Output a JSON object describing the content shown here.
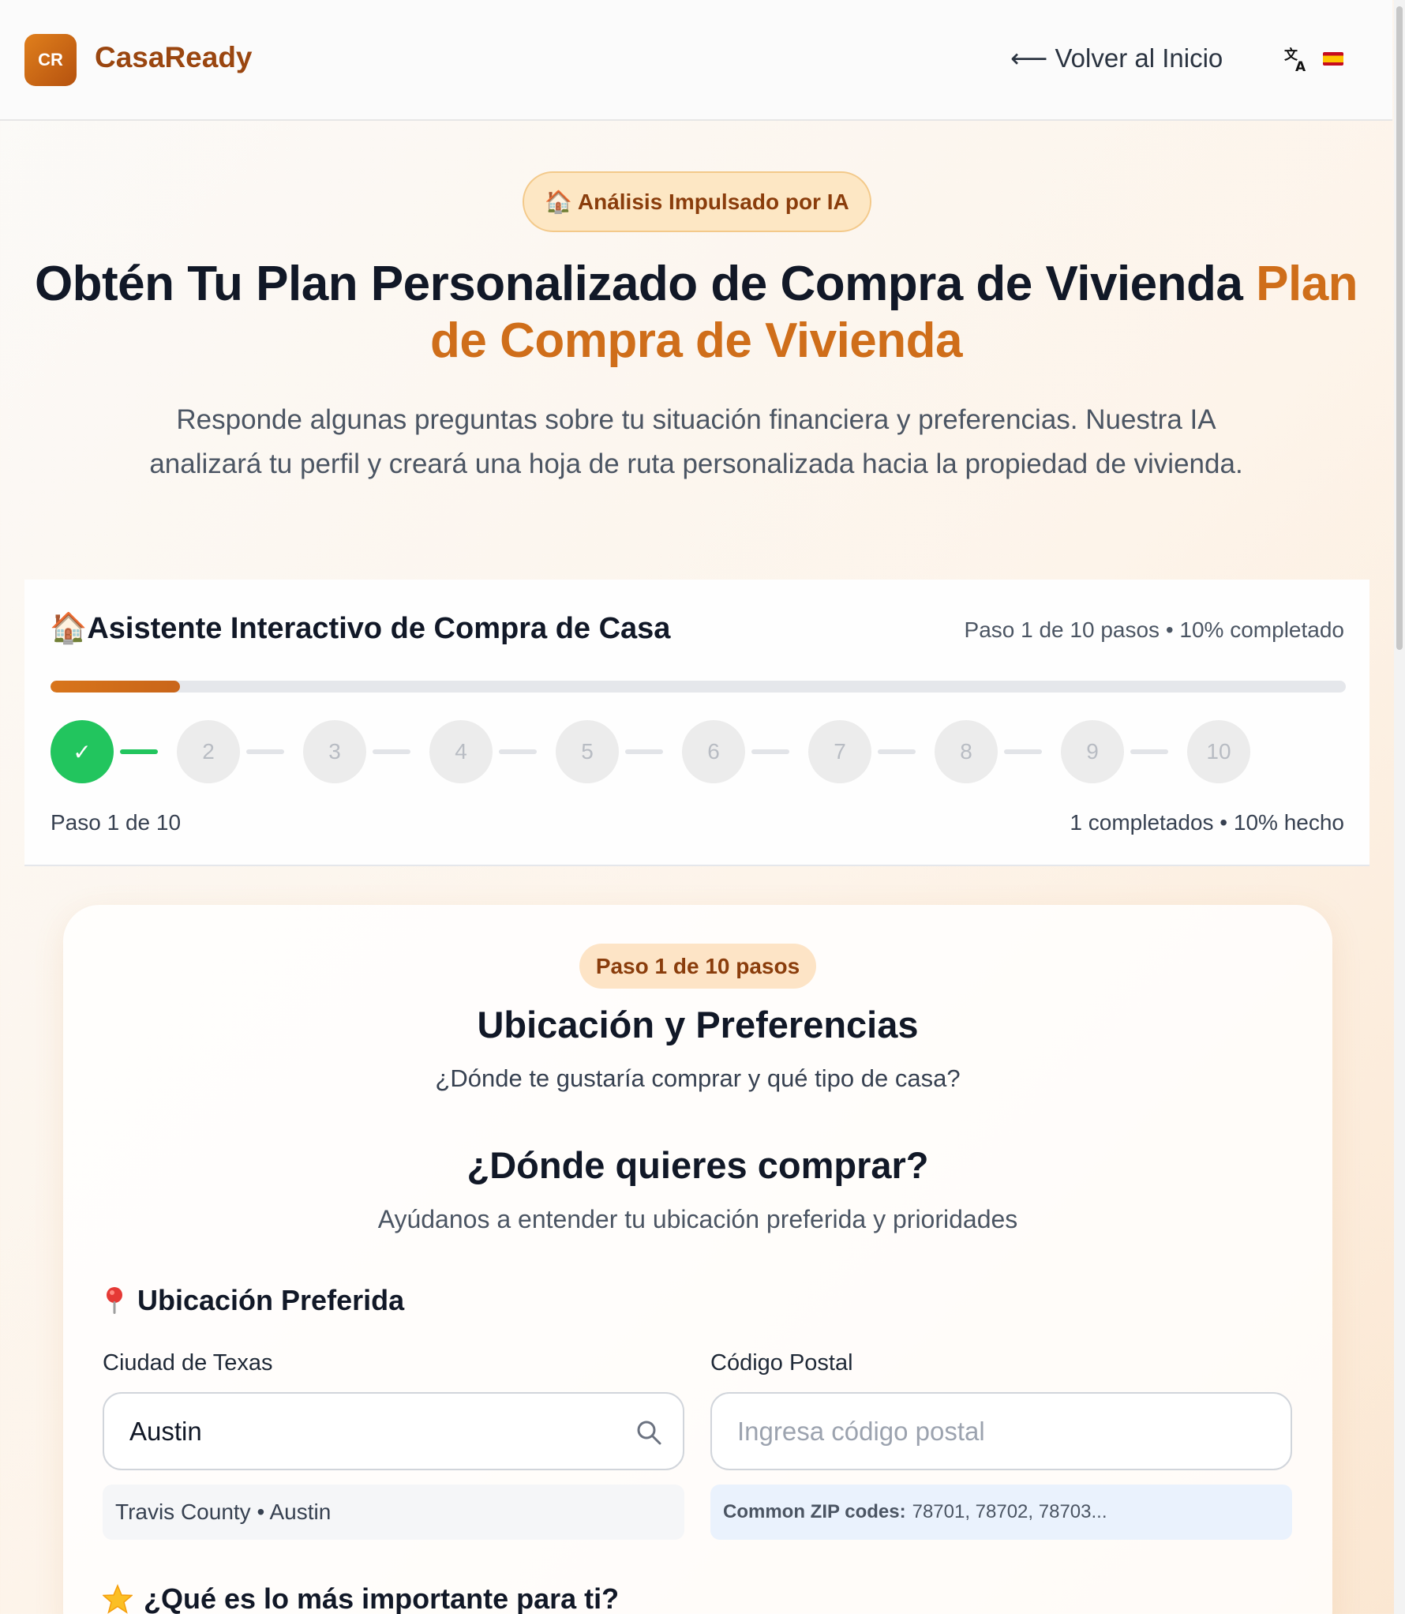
{
  "header": {
    "logo_text": "CR",
    "brand": "CasaReady",
    "back_link": "⟵ Volver al Inicio",
    "translate_icon": "translate-icon",
    "flag_icon": "spain-flag-icon"
  },
  "hero": {
    "badge": "🏠 Análisis Impulsado por IA",
    "title_main": "Obtén Tu Plan Personalizado de Compra de Vivienda ",
    "title_accent": "Plan de Compra de Vivienda",
    "subtitle": "Responde algunas preguntas sobre tu situación financiera y preferencias. Nuestra IA analizará tu perfil y creará una hoja de ruta personalizada hacia la propiedad de vivienda."
  },
  "wizard": {
    "title": "🏠Asistente Interactivo de Compra de Casa",
    "status": "Paso 1 de 10 pasos • 10% completado",
    "progress_fraction": 0.1,
    "steps": [
      "✓",
      "2",
      "3",
      "4",
      "5",
      "6",
      "7",
      "8",
      "9",
      "10"
    ],
    "completed_steps": 1,
    "footer_left": "Paso 1 de 10",
    "footer_right": "1 completados • 10% hecho"
  },
  "card": {
    "step_pill": "Paso 1 de 10 pasos",
    "title": "Ubicación y Preferencias",
    "subtitle": "¿Dónde te gustaría comprar y qué tipo de casa?",
    "question": "¿Dónde quieres comprar?",
    "question_sub": "Ayúdanos a entender tu ubicación preferida y prioridades",
    "location_section": "Ubicación Preferida",
    "city_label": "Ciudad de Texas",
    "city_value": "Austin",
    "city_hint": "Travis County • Austin",
    "zip_label": "Código Postal",
    "zip_placeholder": "Ingresa código postal",
    "zip_hint_label": "Common ZIP codes:",
    "zip_hint_values": "78701, 78702, 78703...",
    "priorities_section": "¿Qué es lo más importante para ti?"
  },
  "colors": {
    "brand": "#9a4610",
    "accent": "#cf6e1a",
    "success": "#22c55e"
  }
}
